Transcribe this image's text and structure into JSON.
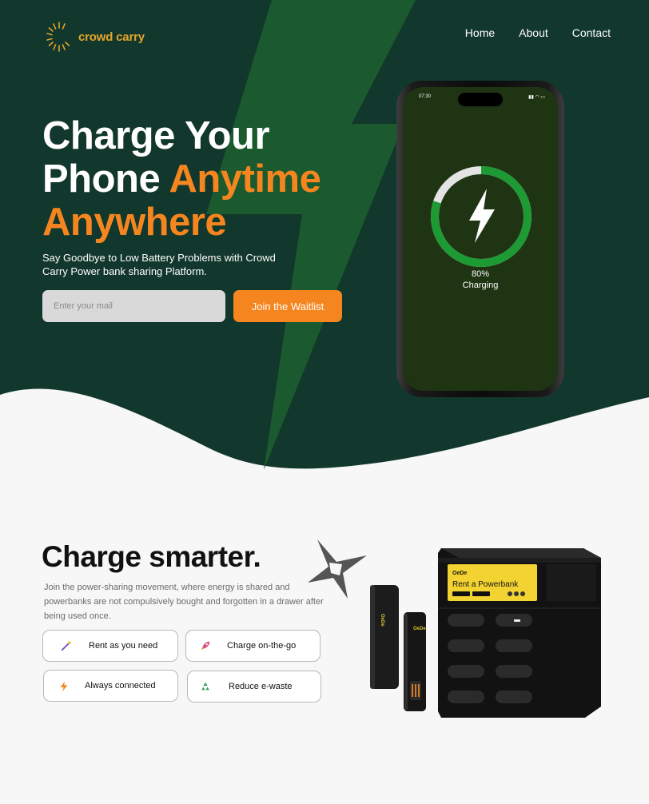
{
  "brand": {
    "name_part1": "crowd",
    "name_part2": "carry"
  },
  "nav": {
    "home": "Home",
    "about": "About",
    "contact": "Contact"
  },
  "hero": {
    "line1": "Charge Your",
    "line2_white": "Phone",
    "line2_orange": "Anytime",
    "line3": "Anywhere",
    "subtitle": "Say Goodbye to Low Battery Problems with Crowd Carry Power bank sharing Platform.",
    "email_placeholder": "Enter your mail",
    "join_label": "Join the Waitlist"
  },
  "phone": {
    "time": "07:30",
    "battery_percent": "80%",
    "battery_fraction": 0.8,
    "status_label": "Charging"
  },
  "section": {
    "title": "Charge smarter.",
    "description": "Join the power-sharing movement, where energy is shared and powerbanks are not compulsively bought and forgotten in a drawer after being used once.",
    "features": [
      {
        "label": "Rent as you need",
        "icon": "magic-wand-icon"
      },
      {
        "label": "Charge on-the-go",
        "icon": "rocket-icon"
      },
      {
        "label": "Always connected",
        "icon": "lightning-icon"
      },
      {
        "label": "Reduce e-waste",
        "icon": "recycle-icon"
      }
    ]
  },
  "kiosk": {
    "screen_text": "Rent a Powerbank"
  },
  "colors": {
    "hero_bg": "#12372c",
    "bolt": "#1b5a2e",
    "accent_orange": "#f5861f",
    "phone_screen": "#1f3412",
    "ring_green": "#1e9a34",
    "kiosk_screen": "#f3d332"
  }
}
